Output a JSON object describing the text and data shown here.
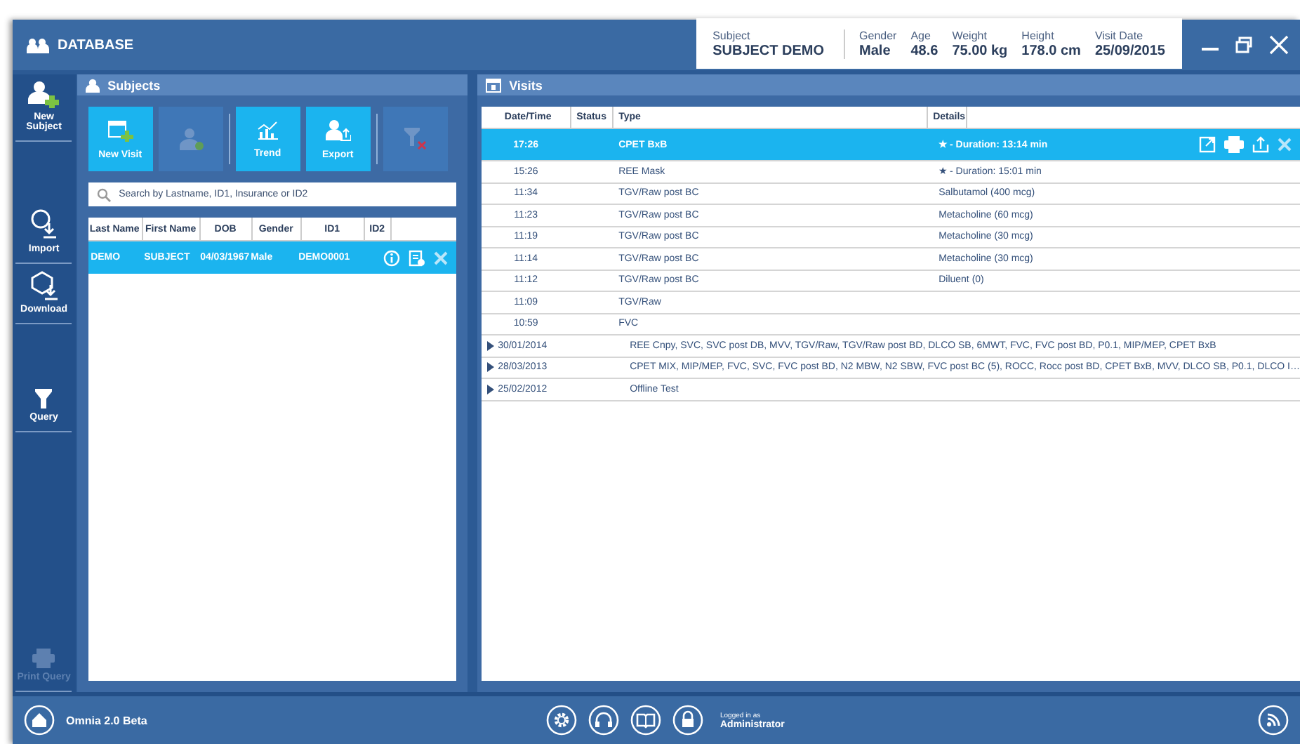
{
  "window": {
    "title": "DATABASE"
  },
  "header_info": [
    {
      "label": "Subject",
      "value": "SUBJECT DEMO"
    },
    {
      "label": "Gender",
      "value": "Male"
    },
    {
      "label": "Age",
      "value": "48.6"
    },
    {
      "label": "Weight",
      "value": "75.00 kg"
    },
    {
      "label": "Height",
      "value": "178.0 cm"
    },
    {
      "label": "Visit Date",
      "value": "25/09/2015"
    }
  ],
  "sidebar": {
    "items": [
      {
        "kind": "new-subject",
        "label": "New Subject",
        "disabled": false
      },
      {
        "kind": "import",
        "label": "Import",
        "disabled": false
      },
      {
        "kind": "download",
        "label": "Download",
        "disabled": false
      },
      {
        "kind": "query",
        "label": "Query",
        "disabled": false
      },
      {
        "kind": "print",
        "label": "Print Query",
        "disabled": true
      }
    ]
  },
  "subjects": {
    "title": "Subjects",
    "toolbar": [
      {
        "kind": "new-visit",
        "label": "New Visit",
        "disabled": false
      },
      {
        "kind": "edit",
        "disabled": true
      },
      {
        "kind": "trend",
        "label": "Trend",
        "disabled": false
      },
      {
        "kind": "export",
        "label": "Export",
        "disabled": false
      },
      {
        "kind": "reset",
        "disabled": true
      }
    ],
    "search": {
      "placeholder": "Search by Lastname, ID1, Insurance or ID2"
    },
    "columns": [
      "Last Name",
      "First Name",
      "DOB",
      "Gender",
      "ID1",
      "ID2"
    ],
    "rows": [
      {
        "cells": [
          "DEMO",
          "SUBJECT",
          "04/03/1967",
          "Male",
          "DEMO0001",
          ""
        ],
        "selected": true
      }
    ]
  },
  "visits": {
    "title": "Visits",
    "columns": [
      "Date/Time",
      "Status",
      "Type",
      "Details"
    ],
    "rows": [
      {
        "kind": "visit",
        "datetime": "17:26",
        "type": "CPET BxB",
        "details": "★ - Duration: 13:14 min",
        "selected": true
      },
      {
        "kind": "visit",
        "datetime": "15:26",
        "type": "REE Mask",
        "details": "★ - Duration: 15:01 min",
        "selected": false
      },
      {
        "kind": "visit",
        "datetime": "11:34",
        "type": "TGV/Raw post BC",
        "details": "Salbutamol (400 mcg)",
        "selected": false
      },
      {
        "kind": "visit",
        "datetime": "11:23",
        "type": "TGV/Raw post BC",
        "details": "Metacholine (60 mcg)",
        "selected": false
      },
      {
        "kind": "visit",
        "datetime": "11:19",
        "type": "TGV/Raw post BC",
        "details": "Metacholine (30 mcg)",
        "selected": false
      },
      {
        "kind": "visit",
        "datetime": "11:14",
        "type": "TGV/Raw post BC",
        "details": "Metacholine (30 mcg)",
        "selected": false
      },
      {
        "kind": "visit",
        "datetime": "11:12",
        "type": "TGV/Raw post BC",
        "details": "Diluent (0)",
        "selected": false
      },
      {
        "kind": "visit",
        "datetime": "11:09",
        "type": "TGV/Raw",
        "selected": false
      },
      {
        "kind": "visit",
        "datetime": "10:59",
        "type": "FVC",
        "selected": false
      },
      {
        "kind": "group",
        "datetime": "30/01/2014",
        "type": "REE Cnpy, SVC, SVC post DB, MVV, TGV/Raw, TGV/Raw post BD, DLCO SB, 6MWT, FVC, FVC post BD, P0.1, MIP/MEP, CPET BxB",
        "selected": false
      },
      {
        "kind": "group",
        "datetime": "28/03/2013",
        "type": "CPET MIX, MIP/MEP, FVC, SVC, FVC post BD, N2 MBW, N2 SBW, FVC post BC (5), ROCC, Rocc post BD, CPET BxB, MVV, DLCO SB, P0.1, DLCO I…",
        "selected": false
      },
      {
        "kind": "group",
        "datetime": "25/02/2012",
        "type": "Offline Test",
        "selected": false
      }
    ]
  },
  "footer": {
    "app_name": "Omnia 2.0 Beta",
    "logged_in_label": "Logged in as",
    "user": "Administrator"
  }
}
